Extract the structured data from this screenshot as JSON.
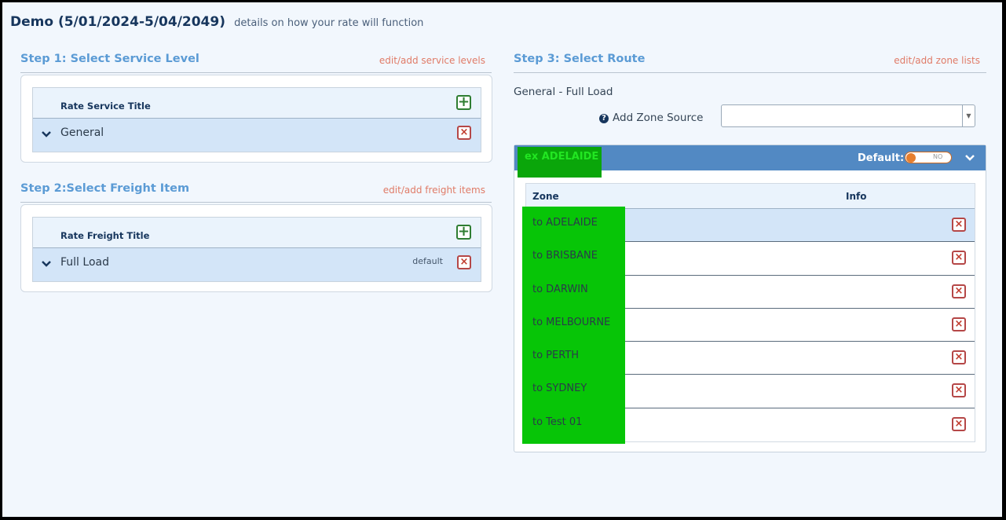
{
  "header": {
    "title": "Demo (5/01/2024-5/04/2049)",
    "subtitle": "details on how your rate will function"
  },
  "step1": {
    "title": "Step 1: Select Service Level",
    "link": "edit/add service levels",
    "column_header": "Rate Service Title",
    "rows": [
      {
        "label": "General"
      }
    ]
  },
  "step2": {
    "title": "Step 2:Select Freight Item",
    "link": "edit/add freight items",
    "column_header": "Rate Freight Title",
    "rows": [
      {
        "label": "Full Load",
        "badge": "default"
      }
    ]
  },
  "step3": {
    "title": "Step 3: Select Route",
    "link": "edit/add zone lists",
    "route_name": "General - Full Load",
    "zone_source_label": "Add Zone Source",
    "zone_source_value": "",
    "origin": {
      "label": "ex ADELAIDE",
      "default_label": "Default:",
      "toggle_text": "NO",
      "toggle_on": false
    },
    "table": {
      "columns": [
        "Zone",
        "Info"
      ],
      "rows": [
        {
          "zone": "to ADELAIDE",
          "info": "",
          "selected": true
        },
        {
          "zone": "to BRISBANE",
          "info": ""
        },
        {
          "zone": "to DARWIN",
          "info": ""
        },
        {
          "zone": "to MELBOURNE",
          "info": ""
        },
        {
          "zone": "to PERTH",
          "info": ""
        },
        {
          "zone": "to SYDNEY",
          "info": ""
        },
        {
          "zone": "to Test 01",
          "info": ""
        }
      ]
    }
  },
  "colors": {
    "accent": "#5b9bd5",
    "link": "#e07b67",
    "bar": "#5289c3",
    "highlight_green": "#07c507"
  }
}
